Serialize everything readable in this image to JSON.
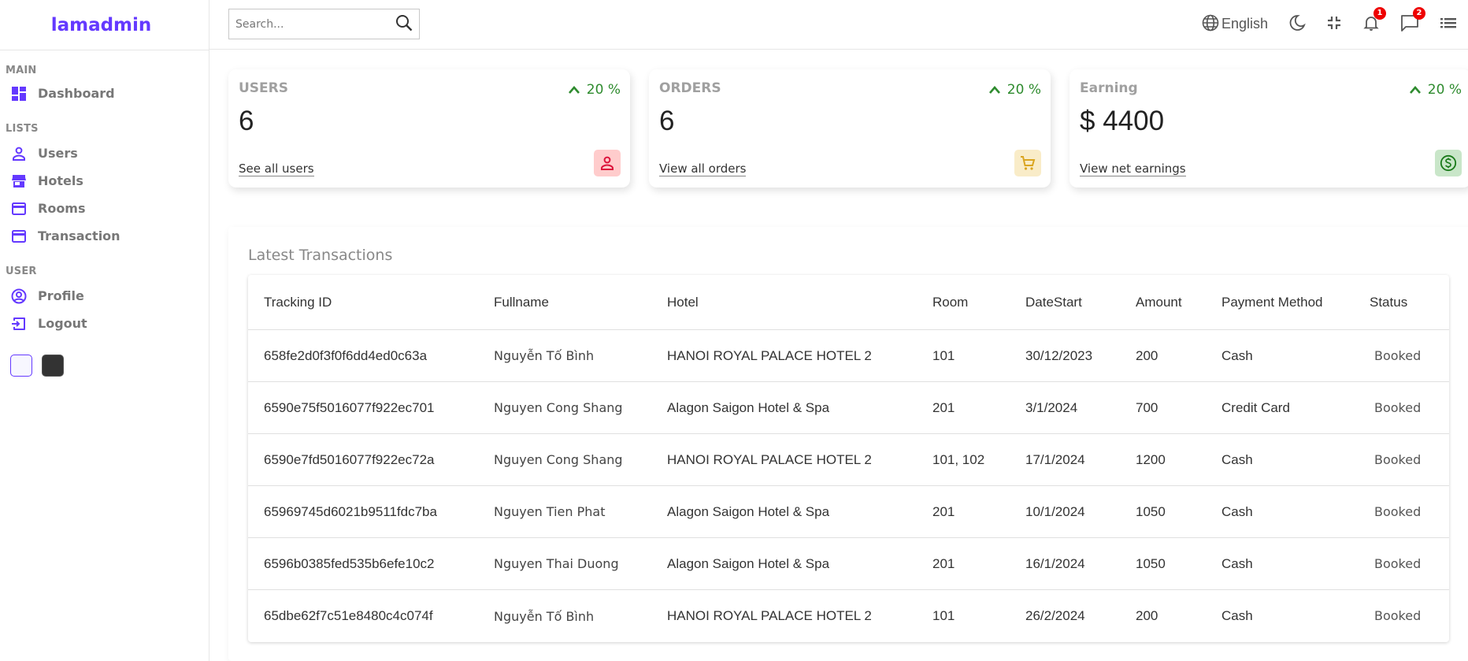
{
  "sidebar": {
    "logo": "lamadmin",
    "sections": {
      "main": "MAIN",
      "lists": "LISTS",
      "user": "USER"
    },
    "items": {
      "dashboard": "Dashboard",
      "users": "Users",
      "hotels": "Hotels",
      "rooms": "Rooms",
      "transaction": "Transaction",
      "profile": "Profile",
      "logout": "Logout"
    },
    "accent_color": "#6439ff"
  },
  "navbar": {
    "search_placeholder": "Search...",
    "language": "English",
    "notifications_count": "1",
    "messages_count": "2"
  },
  "widgets": [
    {
      "title": "USERS",
      "counter": "6",
      "link": "See all users",
      "percentage": "20 %",
      "icon": "person-outline-icon",
      "icon_color": "#dc143c",
      "icon_bg": "#ffcccc"
    },
    {
      "title": "ORDERS",
      "counter": "6",
      "link": "View all orders",
      "percentage": "20 %",
      "icon": "shopping-cart-icon",
      "icon_color": "#daa520",
      "icon_bg": "#f9ecc8"
    },
    {
      "title": "Earning",
      "counter": "$ 4400",
      "link": "View net earnings",
      "percentage": "20 %",
      "icon": "monetization-icon",
      "icon_color": "#1a7a1a",
      "icon_bg": "#c9e6c9"
    }
  ],
  "transactions": {
    "title": "Latest Transactions",
    "columns": [
      "Tracking ID",
      "Fullname",
      "Hotel",
      "Room",
      "DateStart",
      "Amount",
      "Payment Method",
      "Status"
    ],
    "rows": [
      [
        "658fe2d0f3f0f6dd4ed0c63a",
        "Nguyễn Tố Bình",
        "HANOI ROYAL PALACE HOTEL 2",
        "101",
        "30/12/2023",
        "200",
        "Cash",
        "Booked"
      ],
      [
        "6590e75f5016077f922ec701",
        "Nguyen Cong Shang",
        "Alagon Saigon Hotel & Spa",
        "201",
        "3/1/2024",
        "700",
        "Credit Card",
        "Booked"
      ],
      [
        "6590e7fd5016077f922ec72a",
        "Nguyen Cong Shang",
        "HANOI ROYAL PALACE HOTEL 2",
        "101, 102",
        "17/1/2024",
        "1200",
        "Cash",
        "Booked"
      ],
      [
        "65969745d6021b9511fdc7ba",
        "Nguyen Tien Phat",
        "Alagon Saigon Hotel & Spa",
        "201",
        "10/1/2024",
        "1050",
        "Cash",
        "Booked"
      ],
      [
        "6596b0385fed535b6efe10c2",
        "Nguyen Thai Duong",
        "Alagon Saigon Hotel & Spa",
        "201",
        "16/1/2024",
        "1050",
        "Cash",
        "Booked"
      ],
      [
        "65dbe62f7c51e8480c4c074f",
        "Nguyễn Tố Bình",
        "HANOI ROYAL PALACE HOTEL 2",
        "101",
        "26/2/2024",
        "200",
        "Cash",
        "Booked"
      ]
    ]
  }
}
